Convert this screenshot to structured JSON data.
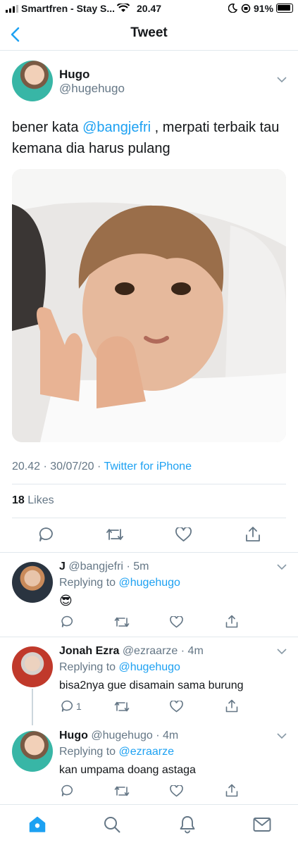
{
  "status_bar": {
    "carrier": "Smartfren - Stay S...",
    "time": "20.47",
    "battery": "91%"
  },
  "nav": {
    "title": "Tweet"
  },
  "main_tweet": {
    "name": "Hugo",
    "handle": "@hugehugo",
    "text_before": "bener kata ",
    "mention": "@bangjefri",
    "text_after": " , merpati terbaik tau kemana dia harus pulang",
    "meta_time": "20.42 · 30/07/20 · ",
    "meta_source": "Twitter for iPhone",
    "likes_count": "18",
    "likes_label": "Likes"
  },
  "replies": [
    {
      "name": "J",
      "handle": "@bangjefri",
      "time": "· 5m",
      "replying_label": "Replying to ",
      "replying_to": "@hugehugo",
      "text": "😎",
      "reply_count": ""
    },
    {
      "name": "Jonah Ezra",
      "handle": "@ezraarze",
      "time": "· 4m",
      "replying_label": "Replying to ",
      "replying_to": "@hugehugo",
      "text": "bisa2nya gue disamain sama burung",
      "reply_count": "1"
    },
    {
      "name": "Hugo",
      "handle": "@hugehugo",
      "time": "· 4m",
      "replying_label": "Replying to ",
      "replying_to": "@ezraarze",
      "text": "kan umpama doang astaga",
      "reply_count": ""
    }
  ],
  "colors": {
    "accent": "#1da1f2",
    "text": "#14171a",
    "muted": "#657786",
    "border": "#e1e8ed"
  },
  "icons": {
    "back": "chevron-left-icon",
    "home": "home-icon",
    "search": "search-icon",
    "notifications": "bell-icon",
    "messages": "mail-icon"
  }
}
